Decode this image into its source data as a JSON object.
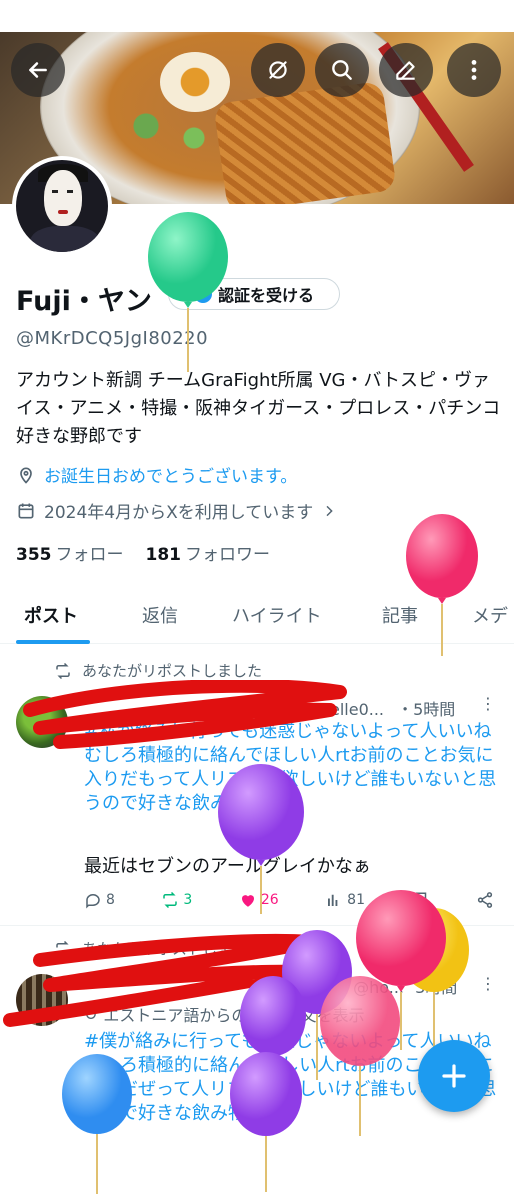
{
  "profile": {
    "name": "Fuji・ヤン",
    "verify_button": "認証を受ける",
    "handle": "@MKrDCQ5JgI80220",
    "bio": "アカウント新調 チームGraFight所属 VG・バトスピ・ヴァイス・アニメ・特撮・阪神タイガース・プロレス・パチンコ好きな野郎です",
    "birthday": "お誕生日おめでとうございます。",
    "joined": "2024年4月からXを利用しています",
    "following_count": "355",
    "following_label": "フォロー",
    "followers_count": "181",
    "followers_label": "フォロワー"
  },
  "header_icons": [
    "back-arrow-icon",
    "hide-replies-icon",
    "search-icon",
    "edit-icon",
    "more-vertical-icon"
  ],
  "tabs": [
    {
      "label": "ポスト",
      "active": true
    },
    {
      "label": "返信"
    },
    {
      "label": "ハイライト"
    },
    {
      "label": "記事"
    },
    {
      "label": "メデ"
    }
  ],
  "posts": [
    {
      "repost_label": "あなたがリポストしました",
      "handle_partial": "elle0...",
      "time": "・5時間",
      "body": "#私が絡みに行っても迷惑じゃないよって人いいねむしろ積極的に絡んでほしい人rtお前のことお気に入りだもって人リプして欲しいけど誰もいないと思うので好きな飲み物を言う",
      "text": "最近はセブンのアールグレイかなぁ",
      "replies": "8",
      "reposts": "3",
      "likes": "26",
      "views": "81"
    },
    {
      "repost_label": "あなたがリポストしました",
      "handle_partial": "バ禁止 @ho...",
      "time": "3時間",
      "translate_label": "エストニア語からの翻訳 原文を表示",
      "body": "#僕が絡みに行っても迷惑じゃないよって人いいねむしろ積極的に絡んでほしい人rtお前のことお気に入りだぜって人リプして欲しいけど誰もいないと思うので好きな飲み物を言う"
    }
  ],
  "colors": {
    "accent": "#1d9bf0",
    "like": "#f91880",
    "repost": "#00ba7c",
    "redaction": "#e01010"
  }
}
